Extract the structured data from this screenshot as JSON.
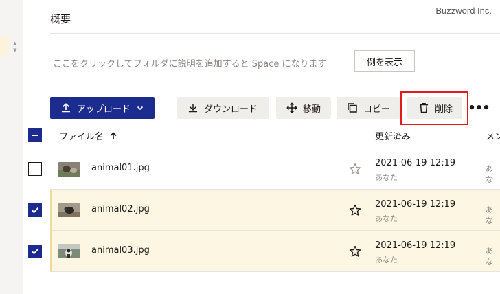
{
  "watermark": "Buzzword Inc.",
  "overview": {
    "title": "概要",
    "description": "ここをクリックしてフォルダに説明を追加すると Space になります",
    "example_button": "例を表示"
  },
  "toolbar": {
    "upload": "アップロード",
    "download": "ダウンロード",
    "move": "移動",
    "copy": "コピー",
    "delete": "削除",
    "more": "•••"
  },
  "table": {
    "columns": {
      "name": "ファイル名",
      "updated": "更新済み",
      "member": "メン"
    },
    "rows": [
      {
        "name": "animal01.jpg",
        "date": "2021-06-19 12:19",
        "by": "あなた",
        "member": "あな",
        "checked": false
      },
      {
        "name": "animal02.jpg",
        "date": "2021-06-19 12:19",
        "by": "あなた",
        "member": "あな",
        "checked": true
      },
      {
        "name": "animal03.jpg",
        "date": "2021-06-19 12:19",
        "by": "あなた",
        "member": "あな",
        "checked": true
      }
    ]
  },
  "colors": {
    "primary": "#1c2c8e",
    "selected_row": "#fdf6e3",
    "highlight": "#e21a1a"
  }
}
